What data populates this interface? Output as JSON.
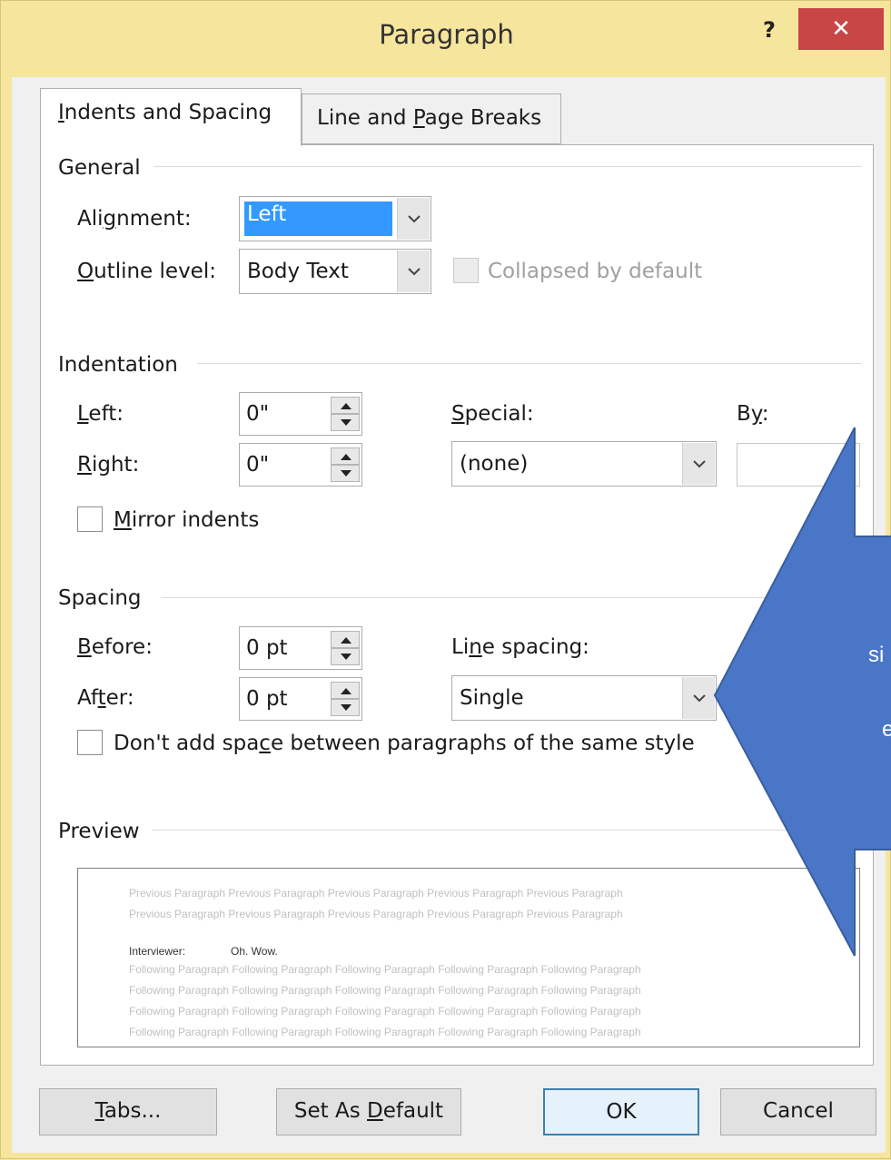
{
  "window": {
    "title": "Paragraph",
    "help_label": "?",
    "close_label": "✕"
  },
  "tabs": [
    {
      "pre": "",
      "key": "I",
      "post": "ndents and Spacing"
    },
    {
      "pre": "Line and ",
      "key": "P",
      "post": "age Breaks"
    }
  ],
  "general": {
    "section_label": "General",
    "alignment_label": {
      "pre": "Ali",
      "key": "g",
      "post": "nment:"
    },
    "alignment_value": "Left",
    "outline_label": {
      "pre": "",
      "key": "O",
      "post": "utline level:"
    },
    "outline_value": "Body Text",
    "collapsed_label": "Collapsed by default"
  },
  "indentation": {
    "section_label": "Indentation",
    "left_label": {
      "pre": "",
      "key": "L",
      "post": "eft:"
    },
    "left_value": "0\"",
    "right_label": {
      "pre": "",
      "key": "R",
      "post": "ight:"
    },
    "right_value": "0\"",
    "special_label": {
      "pre": "",
      "key": "S",
      "post": "pecial:"
    },
    "special_value": "(none)",
    "by_label": {
      "pre": "B",
      "key": "y",
      "post": ":"
    },
    "by_value": "",
    "mirror_label": {
      "pre": "",
      "key": "M",
      "post": "irror indents"
    }
  },
  "spacing": {
    "section_label": "Spacing",
    "before_label": {
      "pre": "",
      "key": "B",
      "post": "efore:"
    },
    "before_value": "0 pt",
    "after_label": {
      "pre": "Af",
      "key": "t",
      "post": "er:"
    },
    "after_value": "0 pt",
    "line_spacing_label": {
      "pre": "Li",
      "key": "n",
      "post": "e spacing:"
    },
    "line_spacing_value": "Single",
    "dont_add_label": {
      "pre": "Don't add spa",
      "key": "c",
      "post": "e between paragraphs of the same style"
    }
  },
  "preview": {
    "section_label": "Preview",
    "previous_lines": [
      "Previous Paragraph Previous Paragraph Previous Paragraph Previous Paragraph Previous Paragraph",
      "Previous Paragraph Previous Paragraph Previous Paragraph Previous Paragraph Previous Paragraph"
    ],
    "current_speaker": "Interviewer:",
    "current_text": "Oh. Wow.",
    "following_lines": [
      "Following Paragraph Following Paragraph Following Paragraph Following Paragraph Following Paragraph",
      "Following Paragraph Following Paragraph Following Paragraph Following Paragraph Following Paragraph",
      "Following Paragraph Following Paragraph Following Paragraph Following Paragraph Following Paragraph",
      "Following Paragraph Following Paragraph Following Paragraph Following Paragraph Following Paragraph"
    ]
  },
  "buttons": {
    "tabs": {
      "pre": "",
      "key": "T",
      "post": "abs..."
    },
    "set_default": {
      "pre": "Set As ",
      "key": "D",
      "post": "efault"
    },
    "ok": "OK",
    "cancel": "Cancel"
  },
  "callout": {
    "fill_color": "#4a76c7",
    "text_line1": "si",
    "text_line2": "e"
  },
  "colors": {
    "title_bar": "#f6e59d",
    "close_button": "#c94646",
    "selection": "#3399ff"
  }
}
